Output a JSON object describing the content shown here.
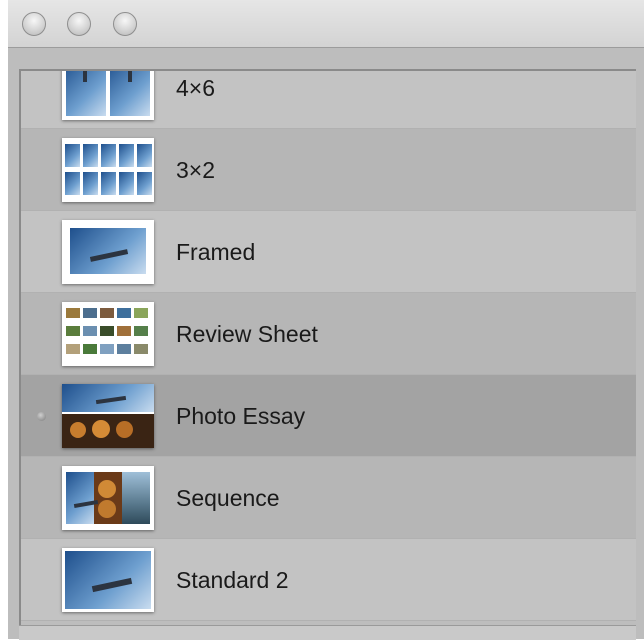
{
  "window": {
    "title_buttons": [
      "close",
      "minimize",
      "zoom"
    ]
  },
  "themes": {
    "selected_index": 4,
    "items": [
      {
        "label": "4×6",
        "thumb": "two-portrait-photos"
      },
      {
        "label": "3×2",
        "thumb": "grid-of-small-photos"
      },
      {
        "label": "Framed",
        "thumb": "framed-jet-photo"
      },
      {
        "label": "Review Sheet",
        "thumb": "contact-sheet"
      },
      {
        "label": "Photo Essay",
        "thumb": "jet-over-coins"
      },
      {
        "label": "Sequence",
        "thumb": "three-panel-sequence"
      },
      {
        "label": "Standard 2",
        "thumb": "full-bleed-jet-photo"
      }
    ]
  }
}
